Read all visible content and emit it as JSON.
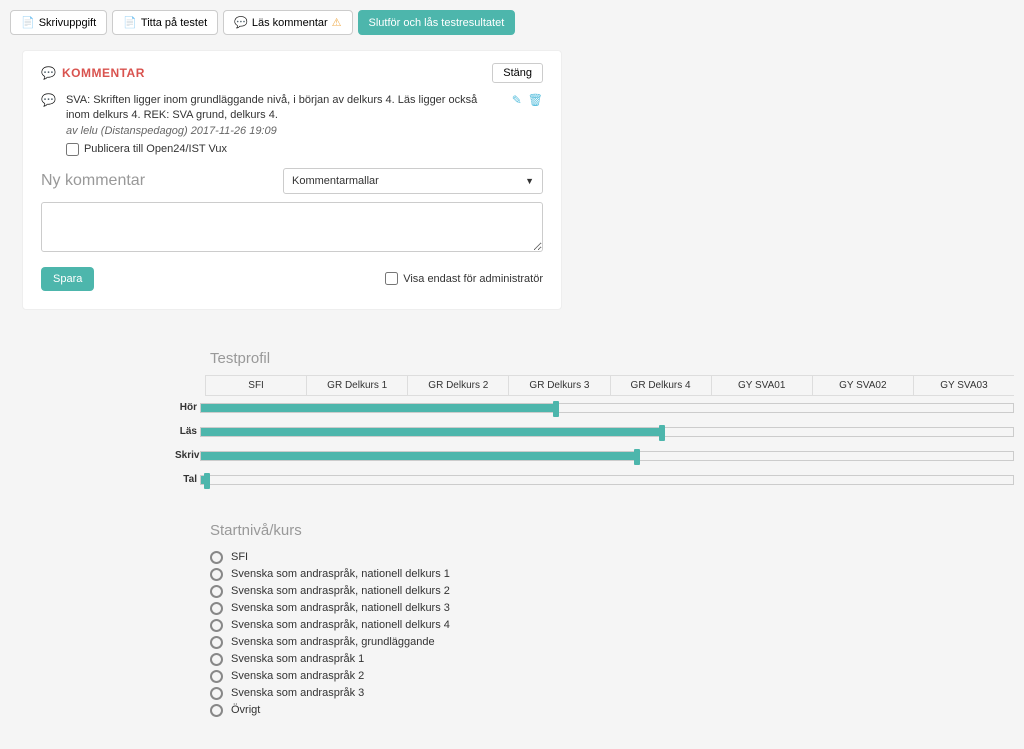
{
  "toolbar": {
    "skriv_label": "Skrivuppgift",
    "titta_label": "Titta på testet",
    "las_label": "Läs kommentar",
    "slutfor_label": "Slutför och lås testresultatet"
  },
  "comment_panel": {
    "title": "KOMMENTAR",
    "close_label": "Stäng",
    "comment_text": "SVA: Skriften ligger inom grundläggande nivå, i början av delkurs 4. Läs ligger också inom delkurs 4. REK: SVA grund, delkurs 4.",
    "comment_meta": "av lelu (Distanspedagog) 2017-11-26 19:09",
    "publish_label": "Publicera till Open24/IST Vux",
    "new_comment_label": "Ny kommentar",
    "template_placeholder": "Kommentarmallar",
    "save_label": "Spara",
    "admin_label": "Visa endast för administratör"
  },
  "testprofil": {
    "title": "Testprofil",
    "columns": [
      "SFI",
      "GR Delkurs 1",
      "GR Delkurs 2",
      "GR Delkurs 3",
      "GR Delkurs 4",
      "GY SVA01",
      "GY SVA02",
      "GY SVA03"
    ],
    "rows": {
      "hor": "Hör",
      "las": "Läs",
      "skriv": "Skriv",
      "tal": "Tal"
    }
  },
  "chart_data": {
    "type": "bar",
    "title": "Testprofil",
    "categories": [
      "Hör",
      "Läs",
      "Skriv",
      "Tal"
    ],
    "x_ticks": [
      "SFI",
      "GR Delkurs 1",
      "GR Delkurs 2",
      "GR Delkurs 3",
      "GR Delkurs 4",
      "GY SVA01",
      "GY SVA02",
      "GY SVA03"
    ],
    "values_pct": [
      44,
      57,
      54,
      1
    ],
    "xlabel": "",
    "ylabel": ""
  },
  "startniva": {
    "title": "Startnivå/kurs",
    "options": [
      "SFI",
      "Svenska som andraspråk, nationell delkurs 1",
      "Svenska som andraspråk, nationell delkurs 2",
      "Svenska som andraspråk, nationell delkurs 3",
      "Svenska som andraspråk, nationell delkurs 4",
      "Svenska som andraspråk, grundläggande",
      "Svenska som andraspråk 1",
      "Svenska som andraspråk 2",
      "Svenska som andraspråk 3",
      "Övrigt"
    ]
  }
}
